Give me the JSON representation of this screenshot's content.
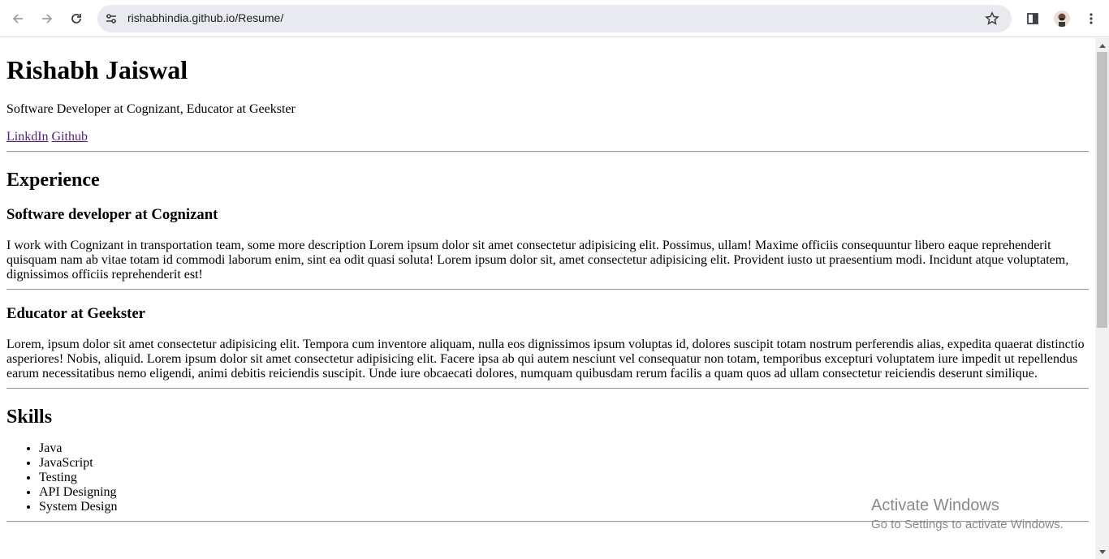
{
  "browser": {
    "url": "rishabhindia.github.io/Resume/",
    "icons": {
      "back": "back-arrow-icon",
      "forward": "forward-arrow-icon",
      "reload": "reload-icon",
      "site_info": "site-info-icon",
      "bookmark": "star-icon",
      "side_panel": "side-panel-icon",
      "profile": "avatar",
      "menu": "kebab-menu-icon"
    }
  },
  "resume": {
    "name": "Rishabh Jaiswal",
    "tagline": "Software Developer at Cognizant, Educator at Geekster",
    "links": {
      "linkedin": "LinkdIn",
      "github": "Github"
    },
    "experience_heading": "Experience",
    "jobs": [
      {
        "title": "Software developer at Cognizant",
        "description": "I work with Cognizant in transportation team, some more description Lorem ipsum dolor sit amet consectetur adipisicing elit. Possimus, ullam! Maxime officiis consequuntur libero eaque reprehenderit quisquam nam ab vitae totam id commodi laborum enim, sint ea odit quasi soluta! Lorem ipsum dolor sit, amet consectetur adipisicing elit. Provident iusto ut praesentium modi. Incidunt atque voluptatem, dignissimos officiis reprehenderit est!"
      },
      {
        "title": "Educator at Geekster",
        "description": "Lorem, ipsum dolor sit amet consectetur adipisicing elit. Tempora cum inventore aliquam, nulla eos dignissimos ipsum voluptas id, dolores suscipit totam nostrum perferendis alias, expedita quaerat distinctio asperiores! Nobis, aliquid. Lorem ipsum dolor sit amet consectetur adipisicing elit. Facere ipsa ab qui autem nesciunt vel consequatur non totam, temporibus excepturi voluptatem iure impedit ut repellendus earum necessitatibus nemo eligendi, animi debitis reiciendis suscipit. Unde iure obcaecati dolores, numquam quibusdam rerum facilis a quam quos ad ullam consectetur reiciendis deserunt similique."
      }
    ],
    "skills_heading": "Skills",
    "skills": [
      "Java",
      "JavaScript",
      "Testing",
      "API Designing",
      "System Design"
    ]
  },
  "watermark": {
    "title": "Activate Windows",
    "subtitle": "Go to Settings to activate Windows."
  }
}
